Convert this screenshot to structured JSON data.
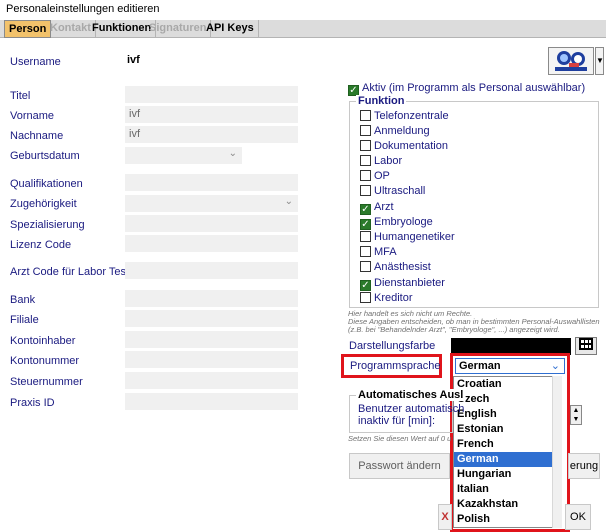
{
  "window": {
    "title": "Personaleinstellungen editieren"
  },
  "tabs": [
    {
      "label": "Person",
      "state": "active"
    },
    {
      "label": "Kontakt",
      "state": "disabled"
    },
    {
      "label": "Funktionen",
      "state": "normal"
    },
    {
      "label": "Signaturen",
      "state": "disabled"
    },
    {
      "label": "API Keys",
      "state": "normal"
    }
  ],
  "person": {
    "username_label": "Username",
    "username_value": "ivf",
    "titel_label": "Titel",
    "titel_value": "",
    "vorname_label": "Vorname",
    "vorname_value": "ivf",
    "nachname_label": "Nachname",
    "nachname_value": "ivf",
    "geburtsdatum_label": "Geburtsdatum",
    "geburtsdatum_value": "",
    "qualifikationen_label": "Qualifikationen",
    "zugehoerigkeit_label": "Zugehörigkeit",
    "spezialisierung_label": "Spezialisierung",
    "lizenz_label": "Lizenz Code",
    "arzt_code_label": "Arzt Code für Labor Tests",
    "bank_label": "Bank",
    "filiale_label": "Filiale",
    "kontoinhaber_label": "Kontoinhaber",
    "kontonummer_label": "Kontonummer",
    "steuernummer_label": "Steuernummer",
    "praxis_label": "Praxis ID"
  },
  "aktiv": {
    "label": "Aktiv (im Programm als Personal auswählbar)",
    "checked": true
  },
  "funktion": {
    "legend": "Funktion",
    "items": [
      {
        "label": "Telefonzentrale",
        "checked": false
      },
      {
        "label": "Anmeldung",
        "checked": false
      },
      {
        "label": "Dokumentation",
        "checked": false
      },
      {
        "label": "Labor",
        "checked": false
      },
      {
        "label": "OP",
        "checked": false
      },
      {
        "label": "Ultraschall",
        "checked": false
      },
      {
        "label": "Arzt",
        "checked": true
      },
      {
        "label": "Embryologe",
        "checked": true
      },
      {
        "label": "Humangenetiker",
        "checked": false
      },
      {
        "label": "MFA",
        "checked": false
      },
      {
        "label": "Anästhesist",
        "checked": false
      },
      {
        "label": "Dienstanbieter",
        "checked": true
      },
      {
        "label": "Kreditor",
        "checked": false
      }
    ]
  },
  "notes": {
    "line1": "Hier handelt es sich nicht um Rechte.",
    "line2": "Diese Angaben entscheiden, ob man in bestimmten Personal-Auswahllisten",
    "line3": "(z.B. bei \"Behandelnder Arzt\", \"Embryologe\", ...) angezeigt wird."
  },
  "darstellungsfarbe": {
    "label": "Darstellungsfarbe",
    "color": "#000000"
  },
  "programmsprache": {
    "label": "Programmsprache",
    "selected": "German",
    "options": [
      "Croatian",
      "Czech",
      "English",
      "Estonian",
      "French",
      "German",
      "Hungarian",
      "Italian",
      "Kazakhstan",
      "Polish"
    ]
  },
  "auto_logout": {
    "legend": "Automatisches Ausl",
    "line1": "Benutzer automatisch",
    "line2": "inaktiv für [min]:",
    "hint": "Setzen Sie diesen Wert auf 0 u"
  },
  "buttons": {
    "passwort": "Passwort ändern",
    "rung": "erung",
    "x": "X",
    "ok": "OK"
  },
  "colors": {
    "accent": "#2f6fd1",
    "highlight": "#e0141b",
    "tab_active": "#f2c26b"
  }
}
